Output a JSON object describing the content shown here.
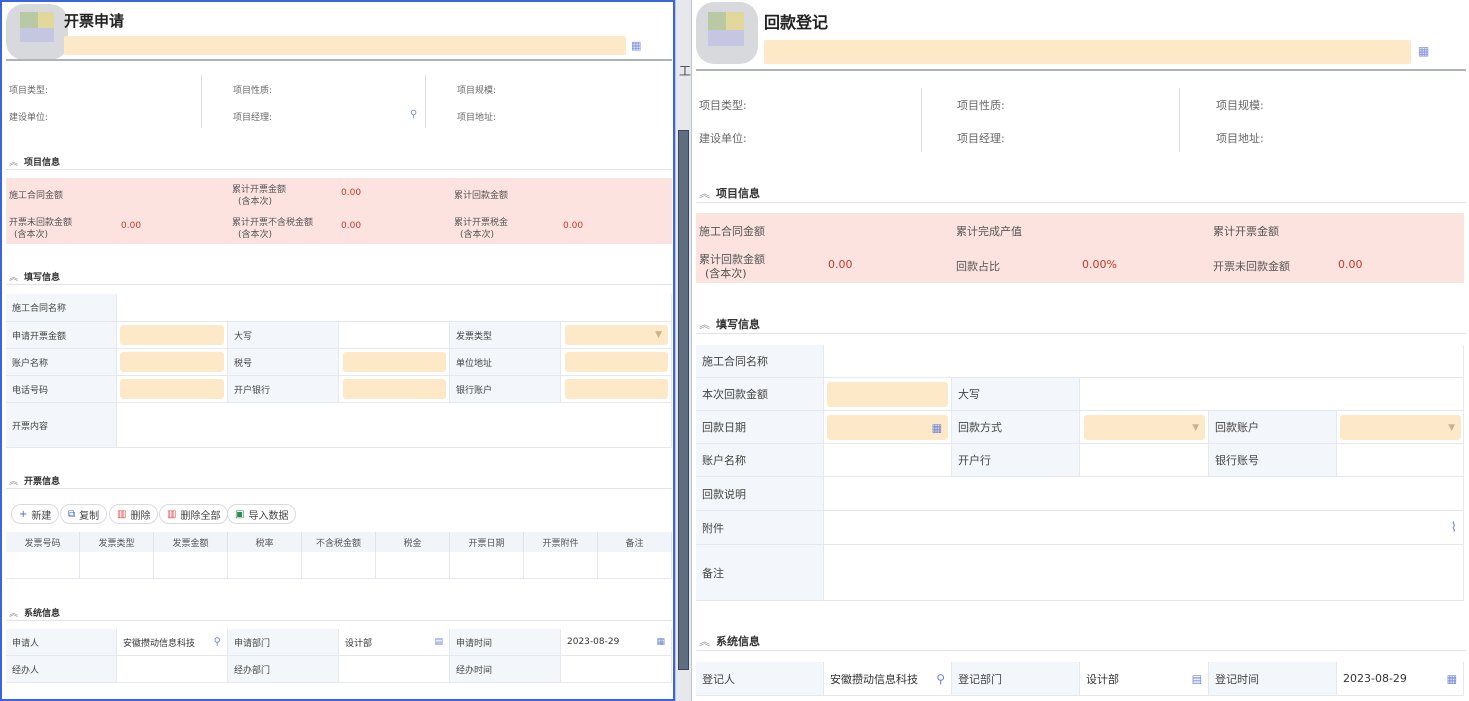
{
  "left": {
    "title": "开票申请",
    "info": {
      "project_type": "项目类型:",
      "project_nature": "项目性质:",
      "project_scale": "项目规模:",
      "construction_unit": "建设单位:",
      "project_manager": "项目经理:",
      "project_address": "项目地址:"
    },
    "section_project": "项目信息",
    "summary": {
      "contract_amount": "施工合同金额",
      "total_invoiced_l1": "累计开票金额",
      "total_invoiced_l2": "(含本次)",
      "total_invoiced_value": "0.00",
      "total_received": "累计回款金额",
      "unreceived_l1": "开票未回款金额",
      "unreceived_l2": "(含本次)",
      "unreceived_value": "0.00",
      "invoiced_excl_tax_l1": "累计开票不含税金额",
      "invoiced_excl_tax_l2": "(含本次)",
      "invoiced_excl_tax_value": "0.00",
      "invoiced_tax_l1": "累计开票税金",
      "invoiced_tax_l2": "(含本次)",
      "invoiced_tax_value": "0.00"
    },
    "section_fill": "填写信息",
    "form": {
      "contract_name": "施工合同名称",
      "apply_amount": "申请开票金额",
      "capital": "大写",
      "invoice_type": "发票类型",
      "account_name": "账户名称",
      "tax_no": "税号",
      "unit_address": "单位地址",
      "phone": "电话号码",
      "bank": "开户银行",
      "bank_account": "银行账户",
      "invoice_content": "开票内容"
    },
    "section_invoice": "开票信息",
    "toolbar": {
      "new": "新建",
      "copy": "复制",
      "delete": "删除",
      "delete_all": "删除全部",
      "import": "导入数据"
    },
    "table_headers": [
      "发票号码",
      "发票类型",
      "发票金额",
      "税率",
      "不含税金额",
      "税金",
      "开票日期",
      "开票附件",
      "备注"
    ],
    "section_system": "系统信息",
    "system": {
      "applicant": "申请人",
      "applicant_value": "安徽攒动信息科技",
      "apply_dept": "申请部门",
      "apply_dept_value": "设计部",
      "apply_time": "申请时间",
      "apply_time_value": "2023-08-29",
      "handler": "经办人",
      "handler_dept": "经办部门",
      "handle_time": "经办时间"
    }
  },
  "right": {
    "title": "回款登记",
    "info": {
      "project_type": "项目类型:",
      "project_nature": "项目性质:",
      "project_scale": "项目规模:",
      "construction_unit": "建设单位:",
      "project_manager": "项目经理:",
      "project_address": "项目地址:"
    },
    "section_project": "项目信息",
    "summary": {
      "contract_amount": "施工合同金额",
      "completed_output": "累计完成产值",
      "total_invoiced": "累计开票金额",
      "total_received_l1": "累计回款金额",
      "total_received_l2": "(含本次)",
      "total_received_value": "0.00",
      "received_ratio": "回款占比",
      "received_ratio_value": "0.00%",
      "unreceived": "开票未回款金额",
      "unreceived_value": "0.00"
    },
    "section_fill": "填写信息",
    "form": {
      "contract_name": "施工合同名称",
      "this_amount": "本次回款金额",
      "capital": "大写",
      "receive_date": "回款日期",
      "receive_method": "回款方式",
      "receive_account": "回款账户",
      "account_name": "账户名称",
      "bank": "开户行",
      "bank_no": "银行账号",
      "description": "回款说明",
      "attachment": "附件",
      "remark": "备注"
    },
    "section_system": "系统信息",
    "system": {
      "registrant": "登记人",
      "registrant_value": "安徽攒动信息科技",
      "reg_dept": "登记部门",
      "reg_dept_value": "设计部",
      "reg_time": "登记时间",
      "reg_time_value": "2023-08-29"
    }
  },
  "gap": {
    "glyph": "工"
  },
  "colors": {
    "accent": "#3b63e6",
    "input_bg": "#fde9c7",
    "summary_bg": "#fde3df",
    "value_red": "#c0392b"
  }
}
